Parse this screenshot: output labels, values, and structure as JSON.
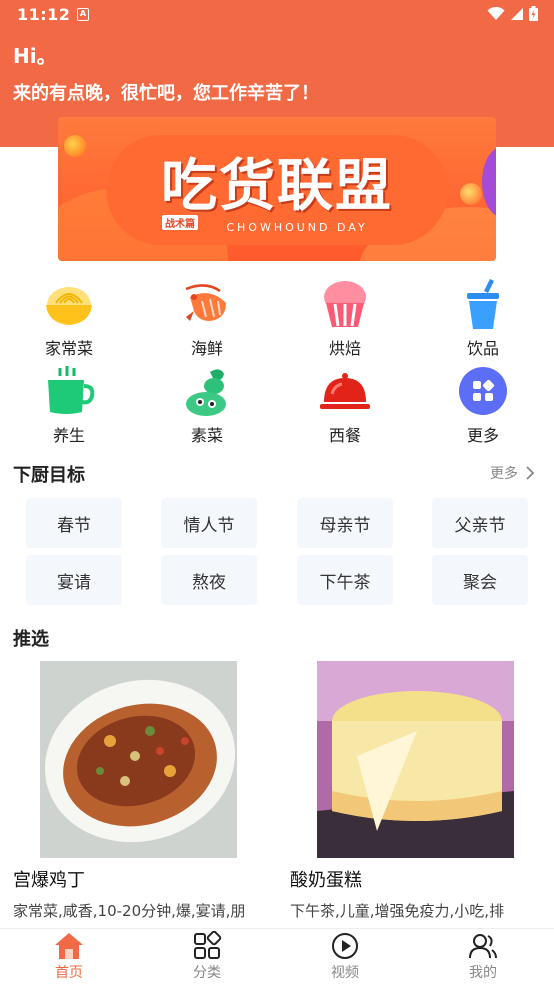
{
  "status": {
    "time": "11:12",
    "indicator": "A"
  },
  "header": {
    "greeting": "Hi。",
    "message": "来的有点晚，很忙吧，您工作辛苦了！"
  },
  "banner": {
    "title": "吃货联盟",
    "tag": "战术篇",
    "subtitle": "CHOWHOUND DAY"
  },
  "categories": [
    {
      "label": "家常菜",
      "icon": "noodle-bowl-icon"
    },
    {
      "label": "海鲜",
      "icon": "shrimp-icon"
    },
    {
      "label": "烘焙",
      "icon": "cupcake-icon"
    },
    {
      "label": "饮品",
      "icon": "drink-cup-icon"
    },
    {
      "label": "养生",
      "icon": "tea-cup-icon"
    },
    {
      "label": "素菜",
      "icon": "vegetable-icon"
    },
    {
      "label": "西餐",
      "icon": "cloche-icon"
    },
    {
      "label": "更多",
      "icon": "more-grid-icon"
    }
  ],
  "goals": {
    "title": "下厨目标",
    "more": "更多",
    "items": [
      "春节",
      "情人节",
      "母亲节",
      "父亲节",
      "宴请",
      "熬夜",
      "下午茶",
      "聚会"
    ]
  },
  "recommend": {
    "title": "推选",
    "items": [
      {
        "name": "宫爆鸡丁",
        "tags": "家常菜,咸香,10-20分钟,爆,宴请,朋"
      },
      {
        "name": "酸奶蛋糕",
        "tags": "下午茶,儿童,增强免疫力,小吃,排"
      }
    ]
  },
  "tabbar": [
    {
      "label": "首页",
      "icon": "home-icon",
      "active": true
    },
    {
      "label": "分类",
      "icon": "category-icon",
      "active": false
    },
    {
      "label": "视频",
      "icon": "video-icon",
      "active": false
    },
    {
      "label": "我的",
      "icon": "profile-icon",
      "active": false
    }
  ],
  "colors": {
    "accent": "#f26a45",
    "goal_bg": "#f4f7fb"
  }
}
